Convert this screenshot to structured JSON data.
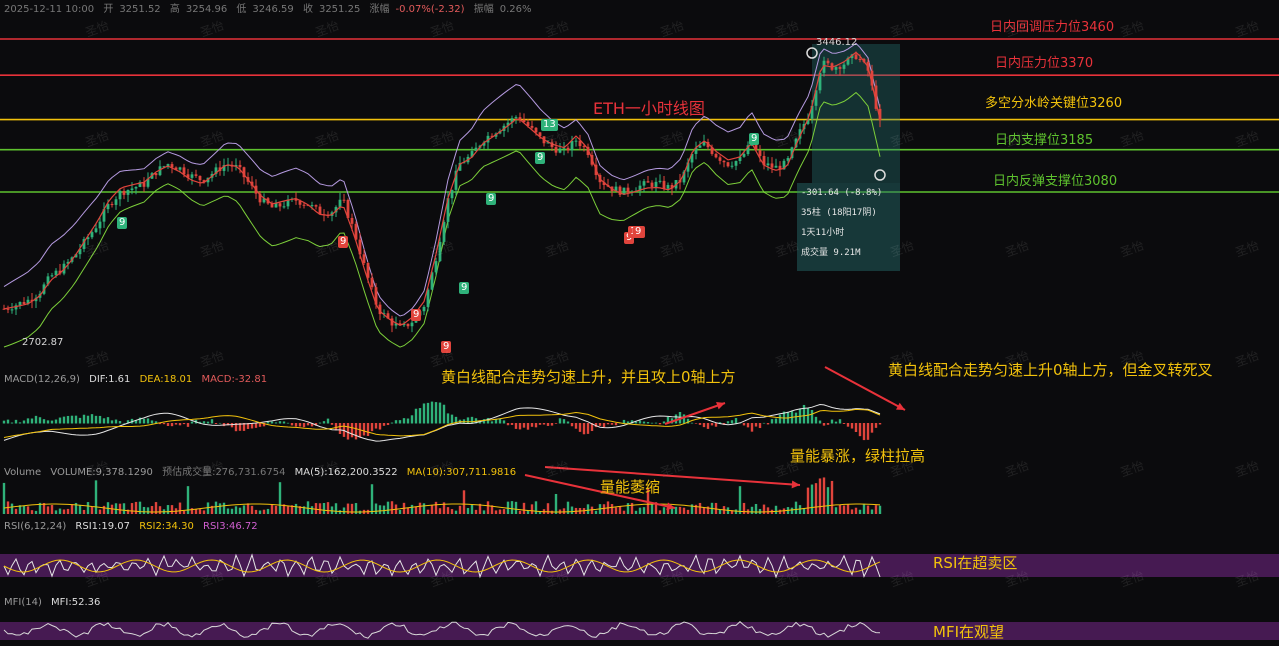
{
  "header": {
    "date": "2025-12-11 10:00",
    "open_label": "开",
    "open": "3251.52",
    "high_label": "高",
    "high": "3254.96",
    "low_label": "低",
    "low": "3246.59",
    "close_label": "收",
    "close": "3251.25",
    "change_label": "涨幅",
    "change": "-0.07%(-2.32)",
    "amp_label": "振幅",
    "amp": "0.26%"
  },
  "price_levels": [
    {
      "label": "日内回调压力位3460",
      "price": 3460,
      "color": "#e8323a"
    },
    {
      "label": "日内压力位3370",
      "price": 3370,
      "color": "#e8323a"
    },
    {
      "label": "多空分水岭关键位3260",
      "price": 3260,
      "color": "#f2c20c"
    },
    {
      "label": "日内支撑位3185",
      "price": 3185,
      "color": "#5ec22e"
    },
    {
      "label": "日内反弹支撑位3080",
      "price": 3080,
      "color": "#5ec22e"
    }
  ],
  "annotations": {
    "title": "ETH一小时线图",
    "macd_note_1": "黄白线配合走势匀速上升，并且攻上0轴上方",
    "macd_note_2": "黄白线配合走势匀速上升0轴上方，但金叉转死叉",
    "vol_note_1": "量能暴涨，绿柱拉高",
    "vol_note_2": "量能萎缩",
    "rsi_note": "RSI在超卖区",
    "mfi_note": "MFI在观望"
  },
  "price_labels": {
    "high_mark": "3446.12",
    "low_mark": "2702.87"
  },
  "td_labels": [
    "9",
    "9",
    "9",
    "9",
    "9",
    "9",
    "9",
    "13",
    "9",
    "9",
    "13",
    "9"
  ],
  "measure_box": {
    "line1": "-301.64 (-8.8%)",
    "line2": "35柱 (18阳17阴)",
    "line3": "1天11小时",
    "line4": "成交量 9.21M"
  },
  "macd": {
    "name": "MACD(12,26,9)",
    "dif": "DIF:1.61",
    "dea": "DEA:18.01",
    "macd": "MACD:-32.81"
  },
  "volume": {
    "name": "Volume",
    "vol": "VOLUME:9,378.1290",
    "est": "预估成交量:276,731.6754",
    "ma5": "MA(5):162,200.3522",
    "ma10": "MA(10):307,711.9816"
  },
  "rsi": {
    "name": "RSI(6,12,24)",
    "rsi1": "RSI1:19.07",
    "rsi2": "RSI2:34.30",
    "rsi3": "RSI3:46.72"
  },
  "mfi": {
    "name": "MFI(14)",
    "value": "MFI:52.36"
  },
  "watermark": "圣怡",
  "chart_data": {
    "type": "line",
    "title": "ETH一小时线图",
    "series": [
      {
        "values": [
          2790,
          2800,
          2810,
          2830,
          2870,
          2890,
          2920,
          2960,
          3000,
          3050,
          3080,
          3090,
          3100,
          3130,
          3150,
          3140,
          3120,
          3110,
          3130,
          3150,
          3140,
          3100,
          3060,
          3040,
          3050,
          3060,
          3050,
          3030,
          3030,
          3060,
          2980,
          2880,
          2790,
          2760,
          2740,
          2760,
          2800,
          2920,
          3060,
          3150,
          3170,
          3210,
          3230,
          3250,
          3270,
          3240,
          3210,
          3190,
          3180,
          3210,
          3180,
          3110,
          3090,
          3080,
          3090,
          3100,
          3100,
          3090,
          3110,
          3180,
          3200,
          3170,
          3150,
          3160,
          3200,
          3150,
          3140,
          3150,
          3220,
          3280,
          3400,
          3390,
          3400,
          3420,
          3380,
          3250
        ]
      }
    ],
    "ylim": [
      2650,
      3500
    ],
    "reference_lines": [
      3460,
      3370,
      3260,
      3185,
      3080
    ],
    "grid": false,
    "indicators": [
      "MACD(12,26,9)",
      "Volume",
      "RSI(6,12,24)",
      "MFI(14)"
    ]
  }
}
